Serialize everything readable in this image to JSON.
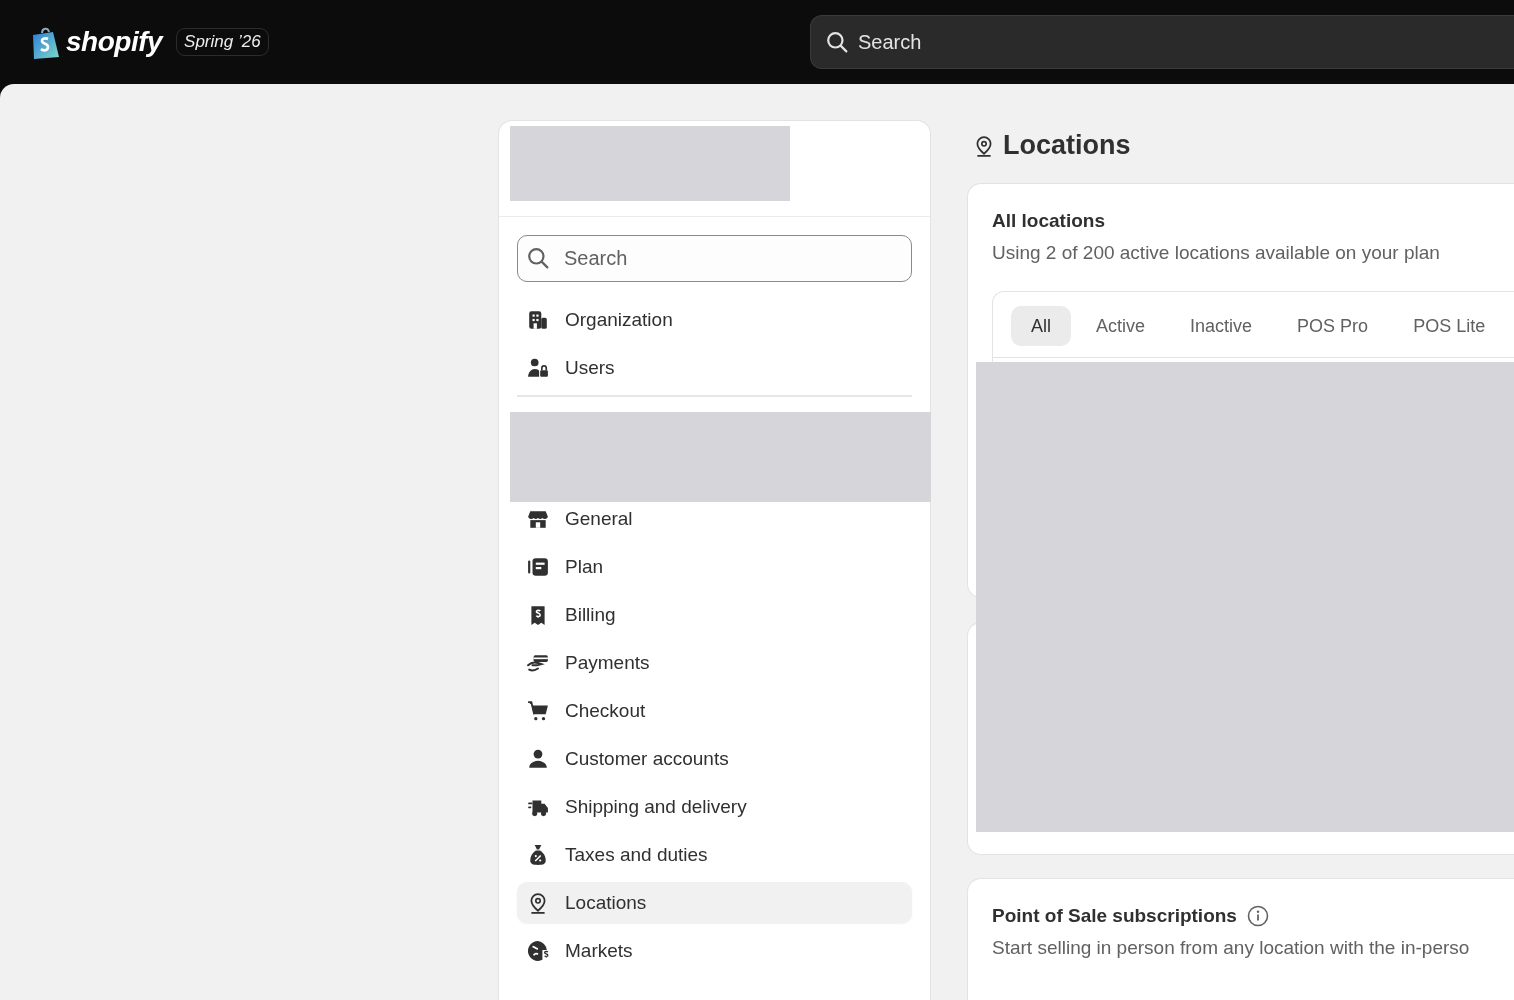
{
  "top_bar": {
    "logo_text": "shopify",
    "edition_badge": "Spring ’26",
    "search": {
      "placeholder": "Search"
    }
  },
  "settings_nav": {
    "search": {
      "placeholder": "Search"
    },
    "account_items": [
      {
        "label": "Organization",
        "kind": "building",
        "selected": false
      },
      {
        "label": "Users",
        "kind": "users",
        "selected": false
      }
    ],
    "store_items": [
      {
        "label": "General",
        "kind": "store",
        "selected": false
      },
      {
        "label": "Plan",
        "kind": "plan",
        "selected": false
      },
      {
        "label": "Billing",
        "kind": "billing",
        "selected": false
      },
      {
        "label": "Payments",
        "kind": "payments",
        "selected": false
      },
      {
        "label": "Checkout",
        "kind": "cart",
        "selected": false
      },
      {
        "label": "Customer accounts",
        "kind": "person",
        "selected": false
      },
      {
        "label": "Shipping and delivery",
        "kind": "truck",
        "selected": false
      },
      {
        "label": "Taxes and duties",
        "kind": "bag",
        "selected": false
      },
      {
        "label": "Locations",
        "kind": "pin",
        "selected": true
      },
      {
        "label": "Markets",
        "kind": "globe",
        "selected": false
      }
    ]
  },
  "page": {
    "title": "Locations",
    "all_locations": {
      "title": "All locations",
      "subtitle": "Using 2 of 200 active locations available on your plan",
      "tabs": [
        {
          "label": "All",
          "selected": true
        },
        {
          "label": "Active",
          "selected": false
        },
        {
          "label": "Inactive",
          "selected": false
        },
        {
          "label": "POS Pro",
          "selected": false
        },
        {
          "label": "POS Lite",
          "selected": false
        }
      ]
    },
    "pos_subscriptions": {
      "title": "Point of Sale subscriptions",
      "description": "Start selling in person from any location with the in-perso"
    }
  }
}
